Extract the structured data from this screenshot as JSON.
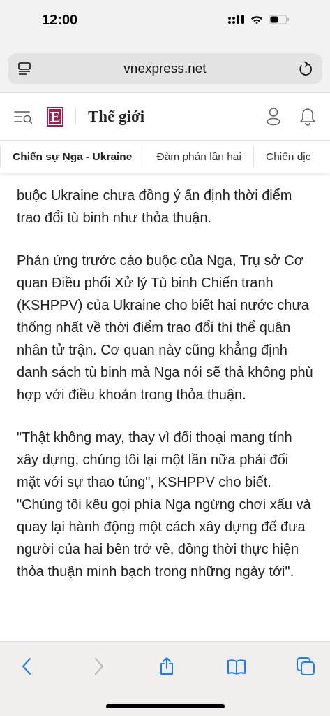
{
  "status_bar": {
    "time": "12:00"
  },
  "address_bar": {
    "url": "vnexpress.net"
  },
  "site_header": {
    "logo": "E",
    "section": "Thế giới"
  },
  "topics": [
    {
      "label": "Chiến sự Nga - Ukraine",
      "selected": true
    },
    {
      "label": "Đàm phán lần hai",
      "selected": false
    },
    {
      "label": "Chiến dịc",
      "selected": false
    }
  ],
  "paragraphs": [
    "buộc Ukraine chưa đồng ý ấn định thời điểm trao đổi tù binh như thỏa thuận.",
    "Phản ứng trước cáo buộc của Nga, Trụ sở Cơ quan Điều phối Xử lý Tù binh Chiến tranh (KSHPPV) của Ukraine cho biết hai nước chưa thống nhất về thời điểm trao đổi thi thể quân nhân tử trận. Cơ quan này cũng khẳng định danh sách tù binh mà Nga nói sẽ thả không phù hợp với điều khoản trong thỏa thuận.",
    "\"Thật không may, thay vì đối thoại mang tính xây dựng, chúng tôi lại một lần nữa phải đối mặt với sự thao túng\", KSHPPV cho biết. \"Chúng tôi kêu gọi phía Nga ngừng chơi xấu và quay lại hành động một cách xây dựng để đưa người của hai bên trở về, đồng thời thực hiện thỏa thuận minh bạch trong những ngày tới\"."
  ],
  "toolbar": [
    {
      "kind": "back",
      "disabled": false
    },
    {
      "kind": "forward",
      "disabled": true
    },
    {
      "kind": "share",
      "disabled": false
    },
    {
      "kind": "bookmarks",
      "disabled": false
    },
    {
      "kind": "tabs",
      "disabled": false
    }
  ]
}
